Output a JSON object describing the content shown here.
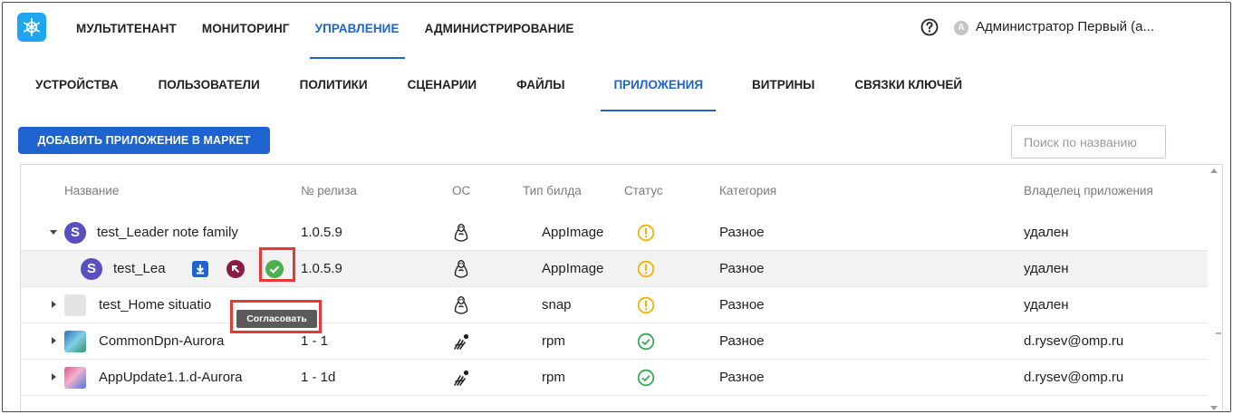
{
  "top_nav": {
    "items": [
      {
        "label": "МУЛЬТИТЕНАНТ",
        "active": false
      },
      {
        "label": "МОНИТОРИНГ",
        "active": false
      },
      {
        "label": "УПРАВЛЕНИЕ",
        "active": true
      },
      {
        "label": "АДМИНИСТРИРОВАНИЕ",
        "active": false
      }
    ],
    "avatar_letter": "A",
    "user_name": "Администратор Первый (а..."
  },
  "sub_tabs": [
    {
      "label": "УСТРОЙСТВА",
      "active": false
    },
    {
      "label": "ПОЛЬЗОВАТЕЛИ",
      "active": false
    },
    {
      "label": "ПОЛИТИКИ",
      "active": false
    },
    {
      "label": "СЦЕНАРИИ",
      "active": false
    },
    {
      "label": "ФАЙЛЫ",
      "active": false
    },
    {
      "label": "ПРИЛОЖЕНИЯ",
      "active": true
    },
    {
      "label": "ВИТРИНЫ",
      "active": false
    },
    {
      "label": "СВЯЗКИ КЛЮЧЕЙ",
      "active": false
    }
  ],
  "toolbar": {
    "add_button": "ДОБАВИТЬ ПРИЛОЖЕНИЕ В МАРКЕТ",
    "search_placeholder": "Поиск по названию"
  },
  "table": {
    "headers": {
      "name": "Название",
      "release": "№ релиза",
      "os": "ОС",
      "build": "Тип билда",
      "status": "Статус",
      "category": "Категория",
      "owner": "Владелец приложения"
    },
    "rows": [
      {
        "name": "test_Leader note family",
        "release": "1.0.5.9",
        "os": "linux",
        "build": "AppImage",
        "status": "warning",
        "category": "Разное",
        "owner": "удален",
        "icon": "S",
        "expanded": true
      },
      {
        "name": "test_Lea",
        "release": "1.0.5.9",
        "os": "linux",
        "build": "AppImage",
        "status": "warning",
        "category": "Разное",
        "owner": "удален",
        "icon": "S",
        "child": true
      },
      {
        "name": "test_Home situatio",
        "release": "",
        "os": "linux",
        "build": "snap",
        "status": "warning",
        "category": "Разное",
        "owner": "удален",
        "icon": "blank"
      },
      {
        "name": "CommonDpn-Aurora",
        "release": "1 - 1",
        "os": "aurora",
        "build": "rpm",
        "status": "ok",
        "category": "Разное",
        "owner": "d.rysev@omp.ru",
        "icon": "img-blue"
      },
      {
        "name": "AppUpdate1.1.d-Aurora",
        "release": "1 - 1d",
        "os": "aurora",
        "build": "rpm",
        "status": "ok",
        "category": "Разное",
        "owner": "d.rysev@omp.ru",
        "icon": "img-pink"
      }
    ]
  },
  "tooltip": "Согласовать",
  "colors": {
    "accent": "#1e63d0",
    "warning": "#f0b400",
    "success": "#34a853",
    "approve": "#4caf50",
    "highlight": "#e53935"
  }
}
